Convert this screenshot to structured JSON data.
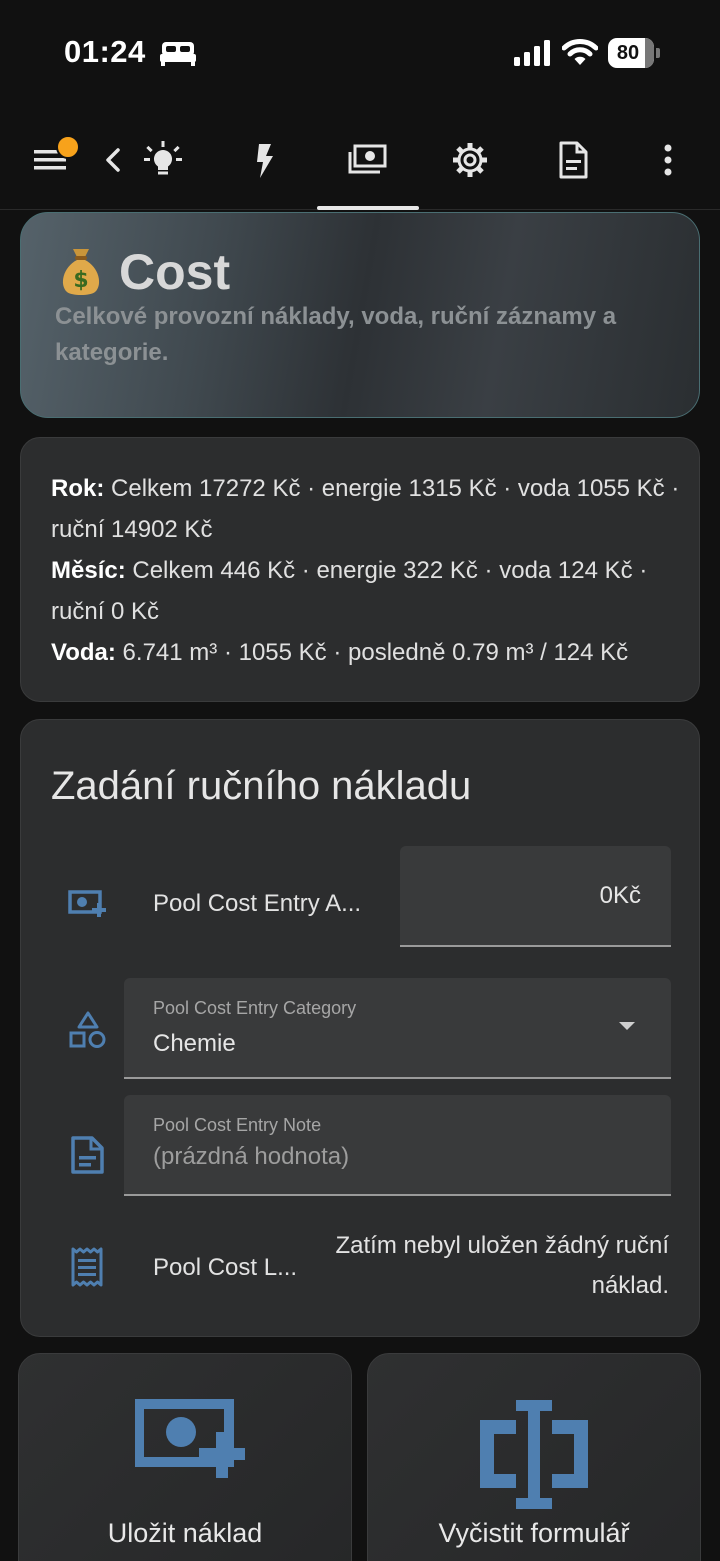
{
  "status_bar": {
    "time": "01:24",
    "battery": "80"
  },
  "toolbar": {
    "icons": [
      "menu-icon",
      "back-icon",
      "lightbulb-icon",
      "flash-icon",
      "cash-icon",
      "gear-icon",
      "document-icon",
      "more-vertical-icon"
    ],
    "active_tab": "cash-icon"
  },
  "hero": {
    "emoji": "money-bag-icon",
    "title": "Cost",
    "subtitle": "Celkové provozní náklady, voda, ruční záznamy a kategorie."
  },
  "summary": {
    "year_label": "Rok:",
    "year_text": " Celkem 17272 Kč · energie 1315 Kč · voda 1055 Kč · ruční 14902 Kč",
    "month_label": "Měsíc:",
    "month_text": " Celkem 446 Kč · energie 322 Kč · voda 124 Kč · ruční 0 Kč",
    "water_label": "Voda:",
    "water_text": " 6.741 m³ · 1055 Kč · posledně 0.79 m³ / 124 Kč"
  },
  "form": {
    "title": "Zadání ručního nákladu",
    "amount_label": "Pool Cost Entry A...",
    "amount_value": "0Kč",
    "category_label": "Pool Cost Entry Category",
    "category_value": "Chemie",
    "note_label": "Pool Cost Entry Note",
    "note_placeholder": "(prázdná hodnota)",
    "log_label": "Pool Cost L...",
    "log_value": "Zatím nebyl uložen žádný ruční náklad."
  },
  "actions": {
    "save_label": "Uložit náklad",
    "clear_label": "Vyčistit formulář"
  },
  "colors": {
    "accent": "#4f7fb0",
    "badge": "#f7a21b",
    "background": "#111111",
    "card": "#2c2d2e"
  }
}
